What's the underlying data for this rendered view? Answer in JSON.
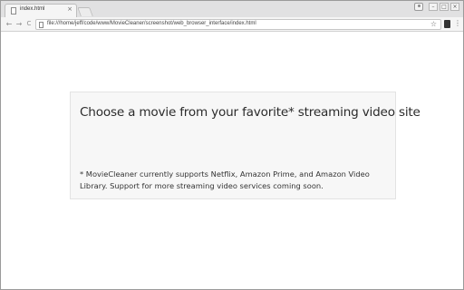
{
  "browser": {
    "tab": {
      "title": "index.html",
      "close_glyph": "×"
    },
    "window_controls": [
      "–",
      "□",
      "×"
    ],
    "address_bar": {
      "url": "file:///home/jeff/code/www/MovieCleaner/screenshot/web_browser_interface/index.html"
    },
    "nav": {
      "back": "←",
      "forward": "→",
      "reload": "C"
    },
    "icons": {
      "bookmark": "☆",
      "menu": "⋮"
    }
  },
  "page": {
    "heading": "Choose a movie from your favorite* streaming video site",
    "footnote": "* MovieCleaner currently supports Netflix, Amazon Prime, and Amazon Video Library. Support for more streaming video services coming soon."
  }
}
